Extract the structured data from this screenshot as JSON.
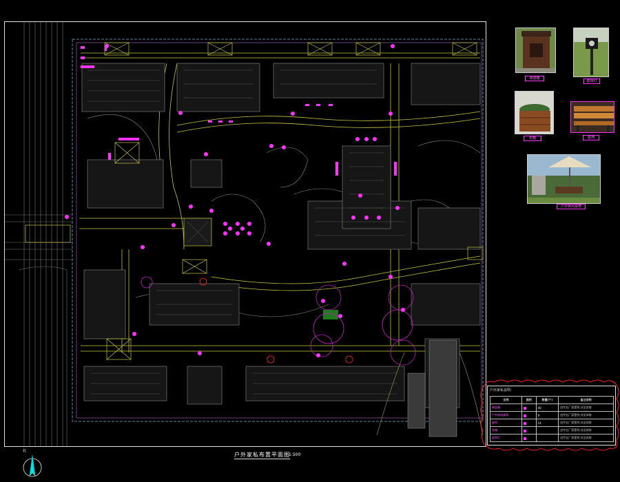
{
  "drawing": {
    "title": "户外家私布置平面图",
    "scale": "1:500",
    "north_label": "北"
  },
  "photos": [
    {
      "name": "trash-bin-photo",
      "caption": "果皮箱"
    },
    {
      "name": "lamp-post-photo",
      "caption": "庭院灯"
    },
    {
      "name": "planter-box-photo",
      "caption": "花箱"
    },
    {
      "name": "bench-photo",
      "caption": "座椅"
    },
    {
      "name": "umbrella-table-photo",
      "caption": "户外休闲桌椅"
    }
  ],
  "legend": {
    "title": "户外家私说明：",
    "headers": [
      "名称",
      "图例",
      "数量(个)",
      "备注说明"
    ],
    "rows": [
      {
        "name": "果皮箱",
        "qty": "40",
        "note": "由专业厂家提供,详见实物"
      },
      {
        "name": "户外休闲桌椅",
        "qty": "9",
        "note": "由专业厂家提供,详见实物"
      },
      {
        "name": "座椅",
        "qty": "14",
        "note": "由专业厂家提供,详见实物"
      },
      {
        "name": "花箱",
        "qty": "",
        "note": "由专业厂家提供,详见实物"
      },
      {
        "name": "庭院灯",
        "qty": "",
        "note": "由专业厂家提供,详见实物"
      }
    ]
  },
  "colors": {
    "background": "#000000",
    "frame": "#e6e6e6",
    "magenta": "#ff33ff",
    "road_yellow": "#c8c84a",
    "building_grey": "#8a8a8a",
    "legend_cloud": "#ff2222"
  },
  "icons": {
    "north": "north-arrow-icon",
    "furniture_marker": "magenta-dot-icon"
  }
}
